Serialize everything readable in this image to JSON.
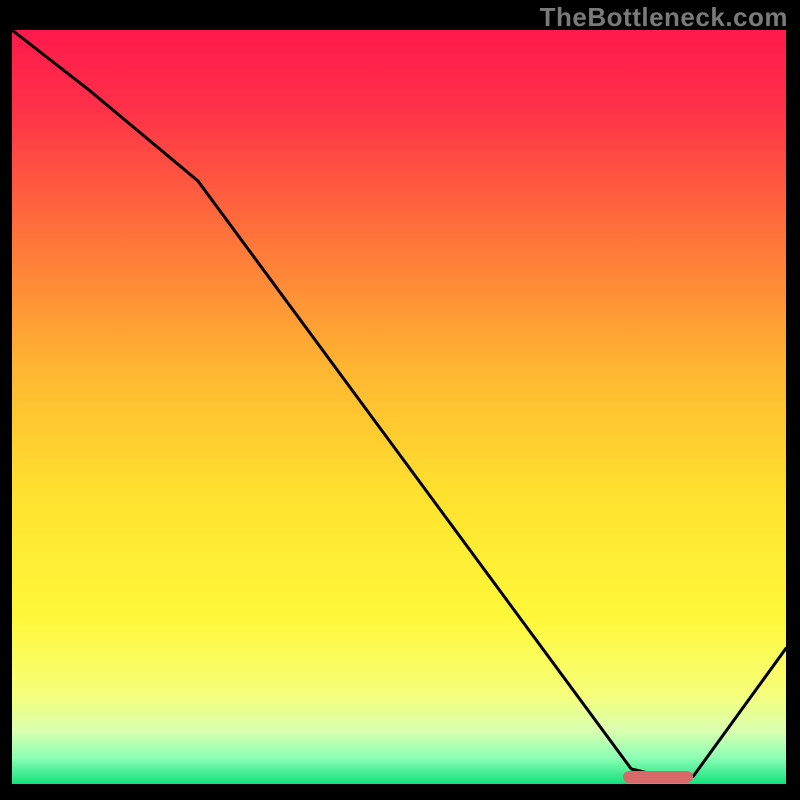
{
  "watermark_text": "TheBottleneck.com",
  "chart_data": {
    "type": "line",
    "title": "",
    "xlabel": "",
    "ylabel": "",
    "xlim": [
      0,
      100
    ],
    "ylim": [
      0,
      100
    ],
    "series": [
      {
        "name": "bottleneck-curve",
        "x": [
          0,
          10,
          24,
          80,
          84,
          88,
          100
        ],
        "y": [
          100,
          92,
          80,
          2,
          1,
          1,
          18
        ],
        "color": "#000000"
      }
    ],
    "highlight_segment": {
      "x_start": 79,
      "x_end": 88,
      "y": 0.9,
      "color": "#d66a6a"
    },
    "background_gradient_stops": [
      {
        "offset": 0.0,
        "color": "#ff1a4b"
      },
      {
        "offset": 0.1,
        "color": "#ff2f49"
      },
      {
        "offset": 0.25,
        "color": "#ff6a3c"
      },
      {
        "offset": 0.45,
        "color": "#ffb631"
      },
      {
        "offset": 0.62,
        "color": "#ffe22f"
      },
      {
        "offset": 0.78,
        "color": "#fff83a"
      },
      {
        "offset": 0.88,
        "color": "#f7ff7a"
      },
      {
        "offset": 0.93,
        "color": "#d9ffb0"
      },
      {
        "offset": 0.965,
        "color": "#8dffb4"
      },
      {
        "offset": 1.0,
        "color": "#14e07b"
      }
    ]
  }
}
